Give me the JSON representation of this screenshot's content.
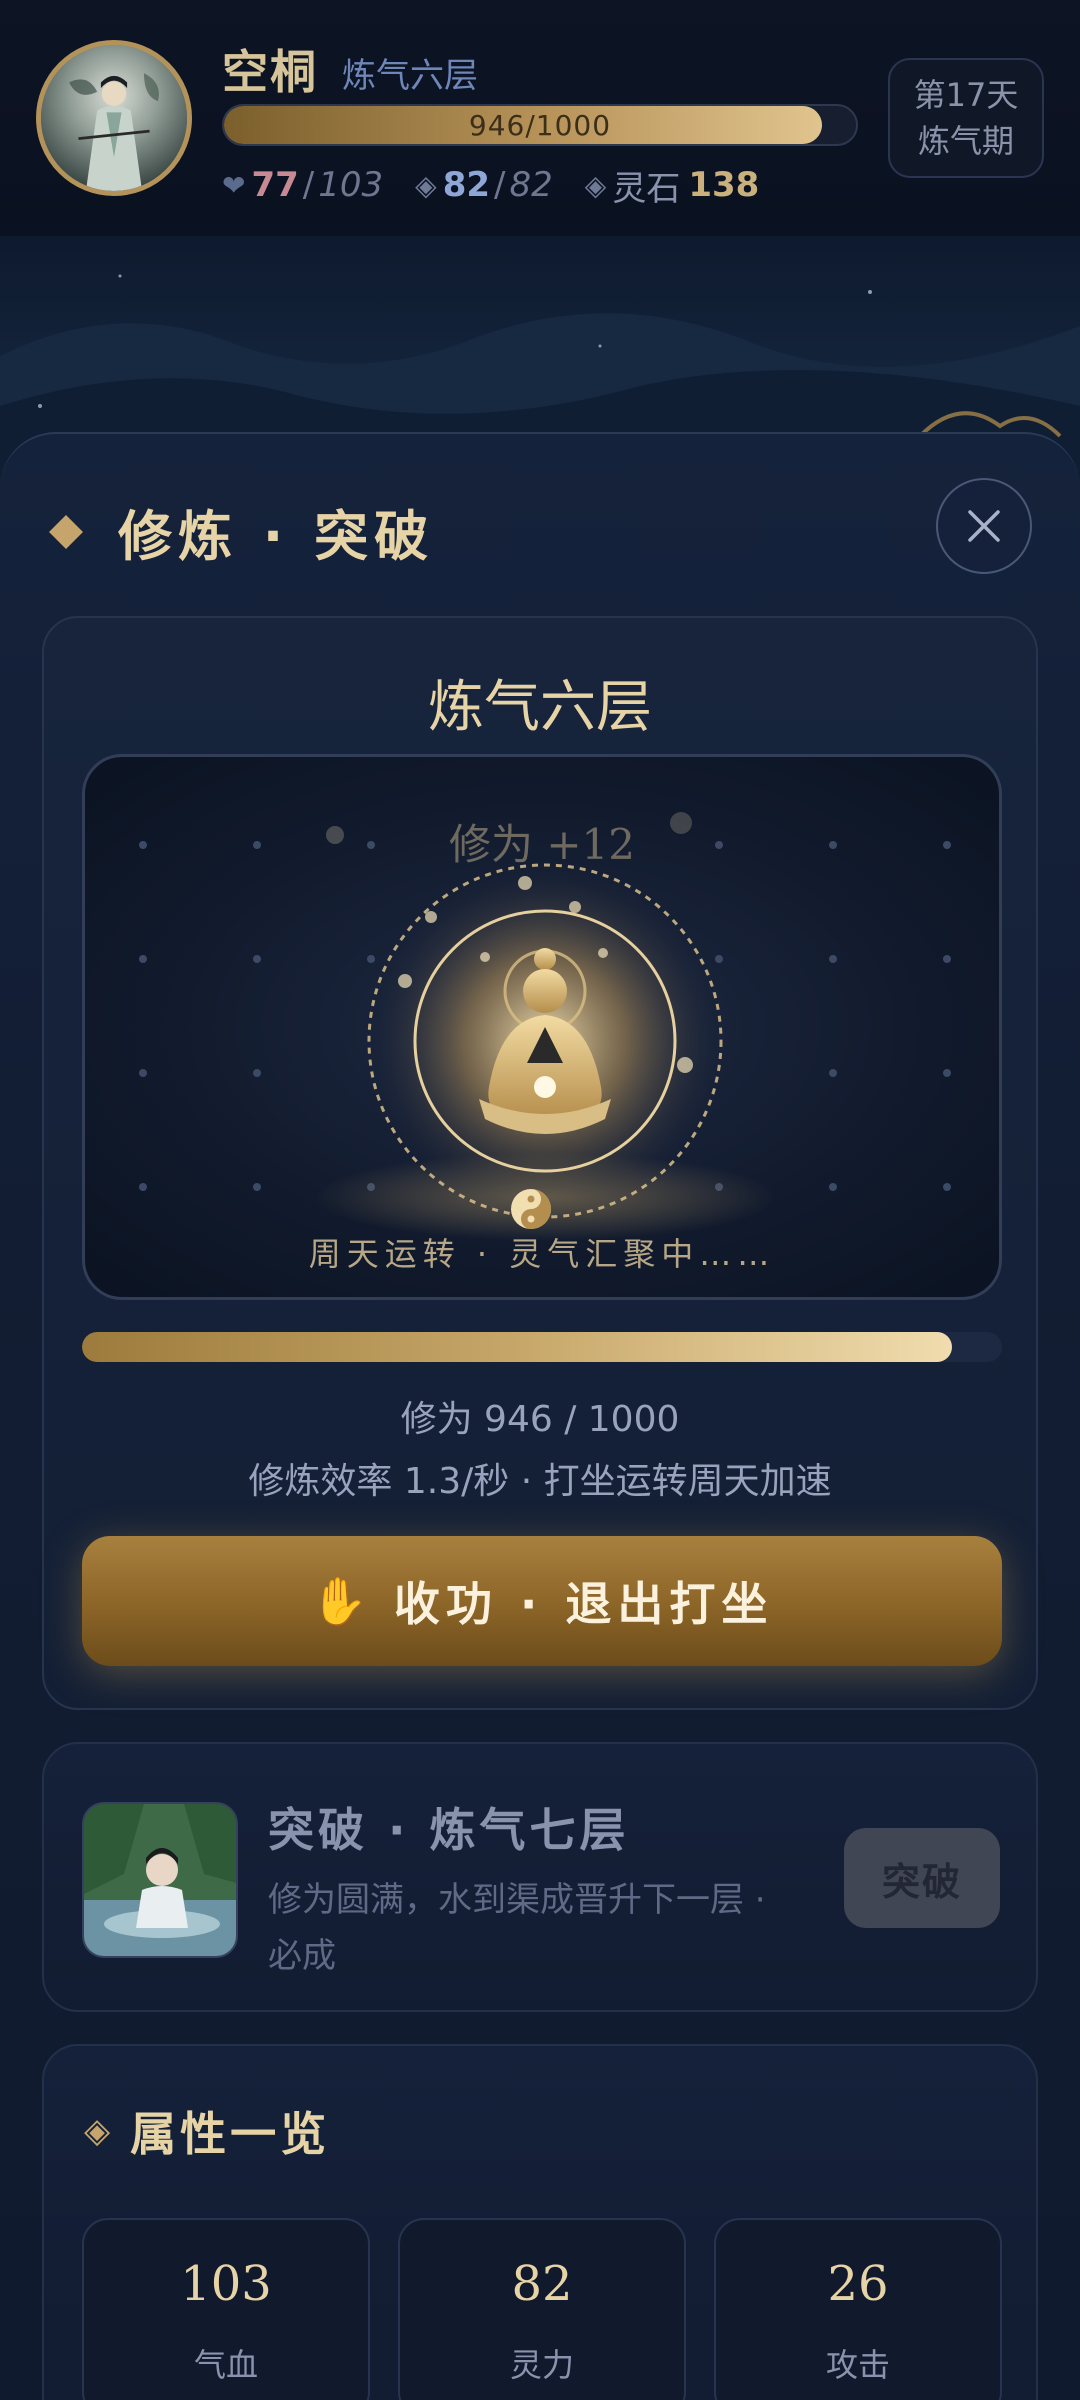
{
  "player": {
    "name": "空桐",
    "realm": "炼气六层",
    "exp_text": "946/1000",
    "exp_fraction": 0.946,
    "hp_current": "77",
    "hp_max": "103",
    "mp_current": "82",
    "mp_max": "82",
    "spirit_stone_label": "灵石",
    "spirit_stone_value": "138"
  },
  "day": {
    "line1": "第17天",
    "line2": "炼气期"
  },
  "panel": {
    "title": "修炼 · 突破"
  },
  "cultivation": {
    "realm": "炼气六层",
    "gain_text": "修为 +12",
    "status_text": "周天运转 · 灵气汇聚中……",
    "progress_fraction": 0.946,
    "exp_line": "修为 946 / 1000",
    "rate_line": "修炼效率 1.3/秒 · 打坐运转周天加速",
    "stop_button": "收功 · 退出打坐"
  },
  "breakthrough": {
    "title": "突破 · 炼气七层",
    "desc": "修为圆满，水到渠成晋升下一层 · 必成",
    "button": "突破"
  },
  "attributes": {
    "title": "属性一览",
    "items": [
      {
        "value": "103",
        "label": "气血"
      },
      {
        "value": "82",
        "label": "灵力"
      },
      {
        "value": "26",
        "label": "攻击"
      }
    ]
  },
  "colors": {
    "gold": "#c5a56c",
    "panel_bg": "#15223b",
    "hp": "#c78a93",
    "mp": "#8fa7d6"
  },
  "icons": {
    "hp": "heart-icon",
    "mp": "diamond-icon",
    "stone": "diamond-icon",
    "close": "close-icon",
    "stop": "hand-icon",
    "attr": "diamond-icon"
  }
}
